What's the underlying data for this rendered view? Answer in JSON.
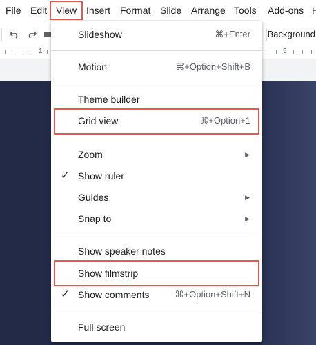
{
  "menubar": {
    "items": [
      "File",
      "Edit",
      "View",
      "Insert",
      "Format",
      "Slide",
      "Arrange",
      "Tools",
      "Add-ons",
      "H"
    ],
    "active": "View"
  },
  "toolbar": {
    "icons": [
      "undo-icon",
      "redo-icon",
      "print-icon"
    ],
    "background_label": "Background"
  },
  "ruler": {
    "numbers": [
      "1",
      "5"
    ]
  },
  "view_menu": {
    "items": [
      {
        "label": "Slideshow",
        "shortcut": "⌘+Enter"
      },
      {
        "label": "Motion",
        "shortcut": "⌘+Option+Shift+B"
      },
      {
        "label": "Theme builder",
        "shortcut": ""
      },
      {
        "label": "Grid view",
        "shortcut": "⌘+Option+1",
        "highlighted": true
      },
      {
        "label": "Zoom",
        "submenu": true
      },
      {
        "label": "Show ruler",
        "checked": true
      },
      {
        "label": "Guides",
        "submenu": true
      },
      {
        "label": "Snap to",
        "submenu": true
      },
      {
        "label": "Show speaker notes"
      },
      {
        "label": "Show filmstrip",
        "highlighted": true
      },
      {
        "label": "Show comments",
        "checked": true,
        "shortcut": "⌘+Option+Shift+N"
      },
      {
        "label": "Full screen"
      }
    ],
    "check_glyph": "✓",
    "arrow_glyph": "▶"
  },
  "colors": {
    "highlight_border": "#e8584d",
    "slide_background": "#232a48"
  }
}
